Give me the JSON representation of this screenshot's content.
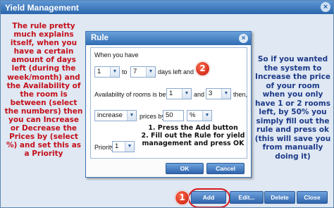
{
  "window": {
    "title": "Yield Management",
    "close_glyph": "×"
  },
  "annotations": {
    "left": "The rule pretty much explains itself, when you have a certain amount of days left (during the week/month) and the Availability of the room is between (select the numbers) then you can Increase or Decrease the Prices by (select %) and set this as a Priority",
    "right": "So if you wanted the system to Increase the price of your room when you only have 1 or 2 rooms left, by 50% you simply fill out the rule and press ok (this will save you from manually doing it)",
    "instructions": "1. Press the Add button\n2. Fill out the Rule for yield management and press OK",
    "badge_1": "1",
    "badge_2": "2"
  },
  "dialog": {
    "title": "Rule",
    "close_glyph": "×",
    "when_label": "When you have",
    "days_from": "1",
    "to_label": "to",
    "days_to": "7",
    "days_left_label": "days left and",
    "availability_label": "Availability of rooms is between",
    "avail_from": "1",
    "and_label": "and",
    "avail_to": "3",
    "then_label": "then,",
    "action": "increase",
    "prices_by_label": "prices by",
    "percent_value": "50",
    "percent_unit": "%",
    "priority_label": "Priority",
    "priority_value": "1",
    "ok_label": "OK",
    "cancel_label": "Cancel",
    "dropdown_glyph": "▼"
  },
  "toolbar": {
    "add_label": "Add",
    "edit_label": "Edit...",
    "delete_label": "Delete",
    "close_label": "Close"
  },
  "colors": {
    "accent": "#2f6cb3",
    "left_text": "#c4101a",
    "right_text": "#1d3a88",
    "badge": "#d8181b"
  }
}
